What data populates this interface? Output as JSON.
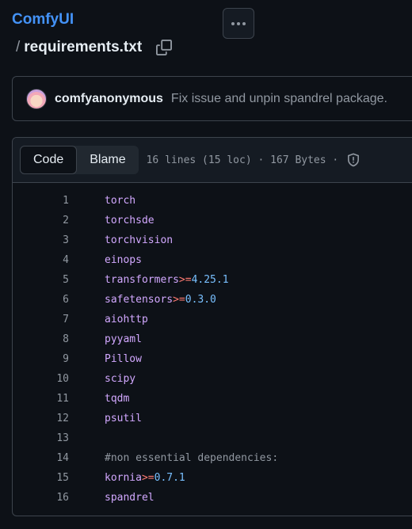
{
  "repo": {
    "name": "ComfyUI"
  },
  "path": {
    "separator": "/",
    "file_name": "requirements.txt"
  },
  "commit": {
    "author": "comfyanonymous",
    "message": "Fix issue and unpin spandrel package."
  },
  "file_header": {
    "tabs": [
      "Code",
      "Blame"
    ],
    "active_tab": "Code",
    "meta": "16 lines (15 loc) · 167 Bytes ·"
  },
  "code_lines": [
    {
      "n": "1",
      "pkg": "torch"
    },
    {
      "n": "2",
      "pkg": "torchsde"
    },
    {
      "n": "3",
      "pkg": "torchvision"
    },
    {
      "n": "4",
      "pkg": "einops"
    },
    {
      "n": "5",
      "pkg": "transformers",
      "op": ">=",
      "ver": "4.25.1"
    },
    {
      "n": "6",
      "pkg": "safetensors",
      "op": ">=",
      "ver": "0.3.0"
    },
    {
      "n": "7",
      "pkg": "aiohttp"
    },
    {
      "n": "8",
      "pkg": "pyyaml"
    },
    {
      "n": "9",
      "pkg": "Pillow"
    },
    {
      "n": "10",
      "pkg": "scipy"
    },
    {
      "n": "11",
      "pkg": "tqdm"
    },
    {
      "n": "12",
      "pkg": "psutil"
    },
    {
      "n": "13"
    },
    {
      "n": "14",
      "comment": "#non essential dependencies:"
    },
    {
      "n": "15",
      "pkg": "kornia",
      "op": ">=",
      "ver": "0.7.1"
    },
    {
      "n": "16",
      "pkg": "spandrel"
    }
  ],
  "icons": [
    "kebab-icon",
    "copy-icon",
    "shield-icon"
  ],
  "colors": {
    "accent": "#4493f8",
    "background": "#0d1117",
    "package": "#d2a8ff",
    "operator": "#ff7b72",
    "version": "#79c0ff"
  }
}
